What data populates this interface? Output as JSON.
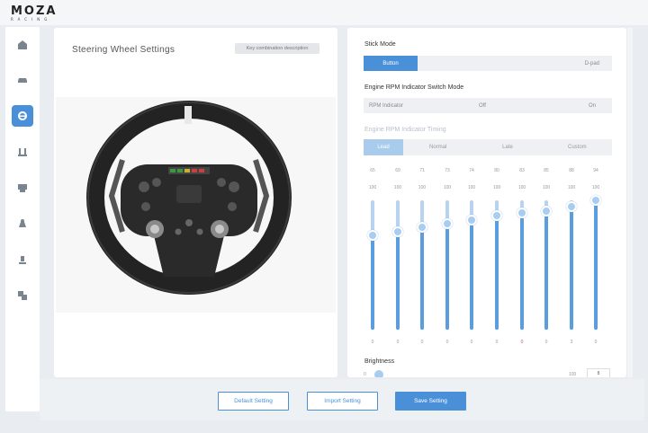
{
  "app": {
    "brand": "MOZA",
    "brand_sub": "RACING"
  },
  "sidebar": {
    "items": [
      {
        "icon": "home-icon",
        "active": false
      },
      {
        "icon": "car-icon",
        "active": false
      },
      {
        "icon": "steering-wheel-icon",
        "active": true
      },
      {
        "icon": "pedals-icon",
        "active": false
      },
      {
        "icon": "shifter-icon",
        "active": false
      },
      {
        "icon": "handbrake-icon",
        "active": false
      },
      {
        "icon": "dashboard-icon",
        "active": false
      },
      {
        "icon": "settings-icon",
        "active": false
      }
    ]
  },
  "left_panel": {
    "title": "Steering Wheel Settings",
    "desc_button": "Key combination description"
  },
  "right_panel": {
    "stick_mode": {
      "label": "Stick Mode",
      "options": [
        "Button",
        "D-pad"
      ],
      "selected": "Button"
    },
    "rpm_switch": {
      "label": "Engine RPM Indicator Switch Mode",
      "options": [
        "RPM Indicator",
        "Off",
        "On"
      ]
    },
    "rpm_timing": {
      "label": "Engine RPM Indicator Timing",
      "options": [
        "Lead",
        "Normal",
        "Late",
        "Custom"
      ],
      "selected": "Lead"
    },
    "sliders": [
      {
        "rpm": "65",
        "pct": "100",
        "level": 0.73,
        "bottom": "0",
        "red": false
      },
      {
        "rpm": "69",
        "pct": "100",
        "level": 0.76,
        "bottom": "0",
        "red": false
      },
      {
        "rpm": "71",
        "pct": "100",
        "level": 0.79,
        "bottom": "0",
        "red": false
      },
      {
        "rpm": "73",
        "pct": "100",
        "level": 0.82,
        "bottom": "0",
        "red": false
      },
      {
        "rpm": "74",
        "pct": "100",
        "level": 0.85,
        "bottom": "0",
        "red": false
      },
      {
        "rpm": "80",
        "pct": "100",
        "level": 0.88,
        "bottom": "0",
        "red": false
      },
      {
        "rpm": "83",
        "pct": "100",
        "level": 0.9,
        "bottom": "0",
        "red": true
      },
      {
        "rpm": "85",
        "pct": "100",
        "level": 0.92,
        "bottom": "0",
        "red": false
      },
      {
        "rpm": "88",
        "pct": "100",
        "level": 0.95,
        "bottom": "3",
        "red": false
      },
      {
        "rpm": "94",
        "pct": "100",
        "level": 1.0,
        "bottom": "0",
        "red": false
      }
    ],
    "brightness": {
      "label": "Brightness",
      "min": "0",
      "max": "100",
      "value": "8",
      "level": 0.08
    }
  },
  "footer": {
    "default_label": "Default Setting",
    "import_label": "Import Setting",
    "save_label": "Save Setting"
  },
  "colors": {
    "accent": "#4a90d9",
    "track": "#b7d3ef",
    "thumb": "#a9cdf0"
  }
}
